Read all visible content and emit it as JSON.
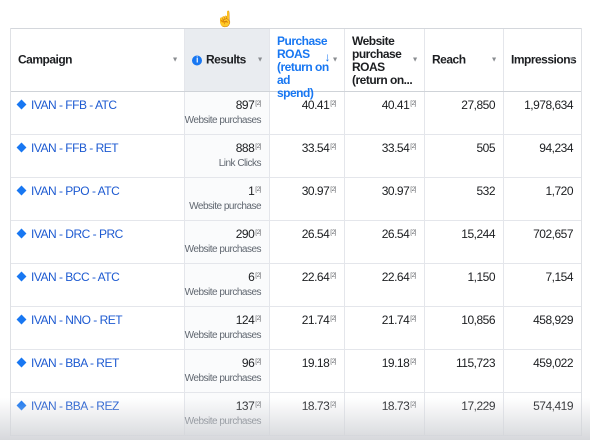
{
  "headers": {
    "campaign": "Campaign",
    "results": "Results",
    "purchase_roas": "Purchase ROAS (return on ad spend)",
    "website_roas": "Website purchase ROAS (return on...",
    "reach": "Reach",
    "impressions": "Impressions"
  },
  "icons": {
    "sort_descending": "arrow-down",
    "column_caret": "caret-down",
    "info": "info-circle",
    "campaign_status": "diamond",
    "cursor": "hand-pointer"
  },
  "colors": {
    "accent": "#1877f2",
    "link": "#1d5ad1",
    "results_header_bg": "#e9ecf0"
  },
  "footnote_marker": "[2]",
  "rows": [
    {
      "campaign": "IVAN - FFB - ATC",
      "results": "897",
      "result_type": "Website purchases",
      "roas": "40.41",
      "website_roas": "40.41",
      "reach": "27,850",
      "impressions": "1,978,634"
    },
    {
      "campaign": "IVAN - FFB - RET",
      "results": "888",
      "result_type": "Link Clicks",
      "roas": "33.54",
      "website_roas": "33.54",
      "reach": "505",
      "impressions": "94,234"
    },
    {
      "campaign": "IVAN - PPO - ATC",
      "results": "1",
      "result_type": "Website purchase",
      "roas": "30.97",
      "website_roas": "30.97",
      "reach": "532",
      "impressions": "1,720"
    },
    {
      "campaign": "IVAN - DRC - PRC",
      "results": "290",
      "result_type": "Website purchases",
      "roas": "26.54",
      "website_roas": "26.54",
      "reach": "15,244",
      "impressions": "702,657"
    },
    {
      "campaign": "IVAN - BCC - ATC",
      "results": "6",
      "result_type": "Website purchases",
      "roas": "22.64",
      "website_roas": "22.64",
      "reach": "1,150",
      "impressions": "7,154"
    },
    {
      "campaign": "IVAN - NNO - RET",
      "results": "124",
      "result_type": "Website purchases",
      "roas": "21.74",
      "website_roas": "21.74",
      "reach": "10,856",
      "impressions": "458,929"
    },
    {
      "campaign": "IVAN - BBA - RET",
      "results": "96",
      "result_type": "Website purchases",
      "roas": "19.18",
      "website_roas": "19.18",
      "reach": "115,723",
      "impressions": "459,022"
    },
    {
      "campaign": "IVAN - BBA - REZ",
      "results": "137",
      "result_type": "Website purchases",
      "roas": "18.73",
      "website_roas": "18.73",
      "reach": "17,229",
      "impressions": "574,419"
    }
  ]
}
